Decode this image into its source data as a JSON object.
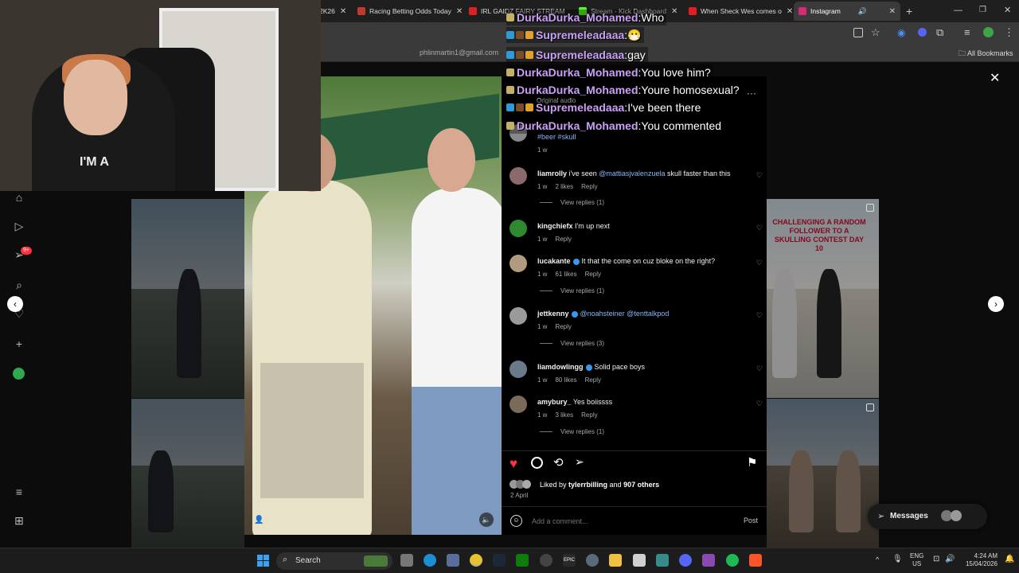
{
  "browser": {
    "tabs": [
      {
        "title": "2K26",
        "color": "#cf6b2a"
      },
      {
        "title": "Racing Betting Odds Today",
        "color": "#c0392b"
      },
      {
        "title": "IRL GAIDZ FAIRY STREAM",
        "color": "#e02020"
      },
      {
        "title": "Stream - Kick Dashboard",
        "color": "#53fc18"
      },
      {
        "title": "When Sheck Wes comes o",
        "color": "#e02020"
      },
      {
        "title": "Instagram",
        "color": "#d62976"
      }
    ],
    "bookmarks_label": "All Bookmarks",
    "new_tab": "+",
    "url_fragment": "phlinmartin1@gmail.com"
  },
  "post": {
    "audio": "Original audio",
    "caption_tags": "#beer #skull",
    "caption_time": "1 w",
    "comments": [
      {
        "user": "liamrolly",
        "text": "i've seen ",
        "mention": "@mattiasjvalenzuela",
        "text2": " skull faster than this",
        "time": "1 w",
        "likes": "2 likes",
        "reply": "Reply",
        "replies": "View replies (1)",
        "verified": false,
        "avatar": "#8a6a6a"
      },
      {
        "user": "kingchiefx",
        "text": "I'm up next",
        "mention": "",
        "text2": "",
        "time": "1 w",
        "likes": "",
        "reply": "Reply",
        "replies": "",
        "verified": false,
        "avatar": "#2f8a2f"
      },
      {
        "user": "lucakante",
        "text": "It that the come on cuz bloke on the right?",
        "mention": "",
        "text2": "",
        "time": "1 w",
        "likes": "61 likes",
        "reply": "Reply",
        "replies": "View replies (1)",
        "verified": true,
        "avatar": "#b09a80"
      },
      {
        "user": "jettkenny",
        "text": "",
        "mention": "@noahsteiner @tenttalkpod",
        "text2": "",
        "time": "1 w",
        "likes": "",
        "reply": "Reply",
        "replies": "View replies (3)",
        "verified": true,
        "avatar": "#9a9a9a"
      },
      {
        "user": "liamdowlingg",
        "text": "Solid pace boys",
        "mention": "",
        "text2": "",
        "time": "1 w",
        "likes": "80 likes",
        "reply": "Reply",
        "replies": "",
        "verified": true,
        "avatar": "#6a7a8a"
      },
      {
        "user": "amybury_",
        "text": "Yes boiissss",
        "mention": "",
        "text2": "",
        "time": "1 w",
        "likes": "3 likes",
        "reply": "Reply",
        "replies": "View replies (1)",
        "verified": false,
        "avatar": "#7a6a5a"
      }
    ],
    "liked_by_prefix": "Liked by ",
    "liked_by_user": "tylerrbilling",
    "liked_by_and": " and ",
    "liked_by_others": "907 others",
    "date": "2 April",
    "add_comment_placeholder": "Add a comment...",
    "post_label": "Post"
  },
  "chat": [
    {
      "user": "DurkaDurka_Mohamed",
      "msg": "Who",
      "badges": [
        "#c5b068"
      ]
    },
    {
      "user": "Supremeleadaaa",
      "msg": "😷",
      "badges": [
        "#2f9bd6",
        "#7a4d2a",
        "#e0a030"
      ]
    },
    {
      "user": "Supremeleadaaa",
      "msg": "gay",
      "badges": [
        "#2f9bd6",
        "#7a4d2a",
        "#e0a030"
      ]
    },
    {
      "user": "DurkaDurka_Mohamed",
      "msg": "You love him?",
      "badges": [
        "#c5b068"
      ]
    },
    {
      "user": "DurkaDurka_Mohamed",
      "msg": "Youre homosexual?",
      "badges": [
        "#c5b068"
      ]
    },
    {
      "user": "Supremeleadaaa",
      "msg": "I've been there",
      "badges": [
        "#2f9bd6",
        "#7a4d2a",
        "#e0a030"
      ]
    },
    {
      "user": "DurkaDurka_Mohamed",
      "msg": "You commented",
      "badges": [
        "#c5b068"
      ]
    }
  ],
  "thumb_text": "CHALLENGING A RANDOM FOLLOWER TO A SKULLING CONTEST DAY 10",
  "webcam_shirt": "I'M A",
  "messages_label": "Messages",
  "notif_badge": "9+",
  "taskbar": {
    "search": "Search",
    "lang": "ENG",
    "region": "US",
    "time": "4:24 AM",
    "date": "15/04/2026"
  }
}
